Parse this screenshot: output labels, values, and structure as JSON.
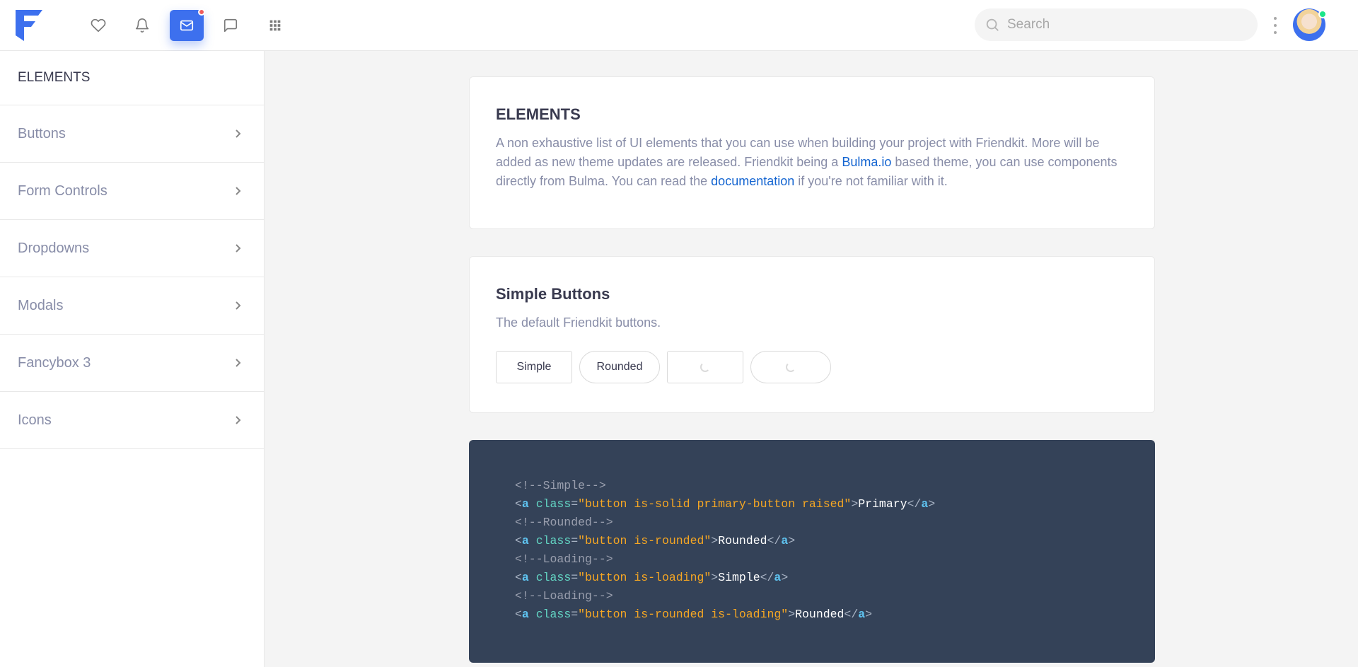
{
  "navbar": {
    "search_placeholder": "Search",
    "icons": [
      "heart-icon",
      "bell-icon",
      "mail-icon",
      "chat-icon",
      "apps-grid-icon"
    ],
    "active_icon": "mail-icon",
    "accent_color": "#3d70ee"
  },
  "sidebar": {
    "header": "ELEMENTS",
    "items": [
      {
        "label": "Buttons"
      },
      {
        "label": "Form Controls"
      },
      {
        "label": "Dropdowns"
      },
      {
        "label": "Modals"
      },
      {
        "label": "Fancybox 3"
      },
      {
        "label": "Icons"
      }
    ]
  },
  "intro": {
    "title": "ELEMENTS",
    "text_1": "A non exhaustive list of UI elements that you can use when building your project with Friendkit. More will be added as new theme updates are released. Friendkit being a ",
    "link_1": "Bulma.io",
    "text_2": " based theme, you can use components directly from Bulma. You can read the ",
    "link_2": "documentation",
    "text_3": " if you're not familiar with it."
  },
  "buttons_section": {
    "title": "Simple Buttons",
    "subtitle": "The default Friendkit buttons.",
    "simple_label": "Simple",
    "rounded_label": "Rounded"
  },
  "code": {
    "comment_simple": "<!--Simple-->",
    "comment_rounded": "<!--Rounded-->",
    "comment_loading": "<!--Loading-->",
    "comment_loading_2": "<!--Loading-->",
    "class_1": "\"button is-solid primary-button raised\"",
    "text_1": "Primary",
    "class_2": "\"button is-rounded\"",
    "text_2": "Rounded",
    "class_3": "\"button is-loading\"",
    "text_3": "Simple",
    "class_4": "\"button is-rounded is-loading\"",
    "text_4": "Rounded",
    "tag": "a",
    "attr": "class"
  }
}
